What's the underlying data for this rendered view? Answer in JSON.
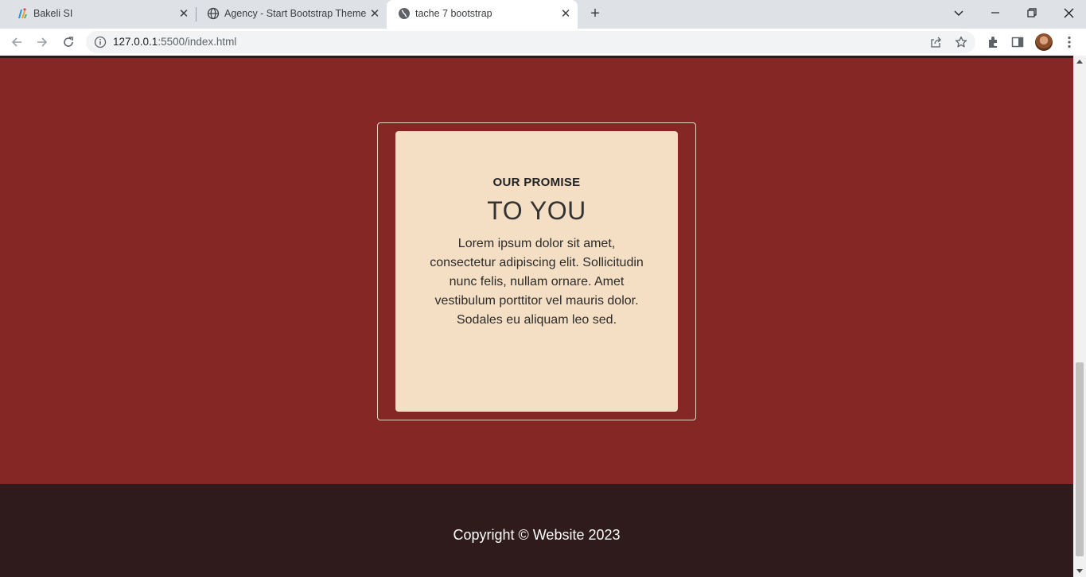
{
  "browser": {
    "tabs": [
      {
        "title": "Bakeli SI",
        "icon": "bakeli-logo-icon",
        "active": false
      },
      {
        "title": "Agency - Start Bootstrap Theme",
        "icon": "globe-icon",
        "active": false
      },
      {
        "title": "tache 7 bootstrap",
        "icon": "globe-icon",
        "active": true
      }
    ],
    "url_host": "127.0.0.1",
    "url_path": ":5500/index.html"
  },
  "section": {
    "kicker": "OUR PROMISE",
    "headline": "TO YOU",
    "body": "Lorem ipsum dolor sit amet, consectetur adipiscing elit. Sollicitudin nunc felis, nullam ornare. Amet vestibulum porttitor vel mauris dolor. Sodales eu aliquam leo sed."
  },
  "footer": {
    "copyright": "Copyright © Website 2023"
  },
  "colors": {
    "section_bg": "#852725",
    "card_bg": "#f5dfc4",
    "footer_bg": "#2f1b1b"
  }
}
